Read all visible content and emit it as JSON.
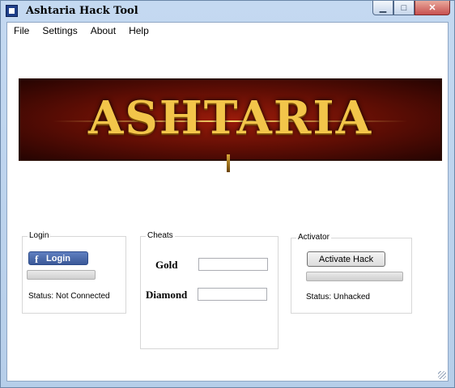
{
  "window": {
    "title": "Ashtaria Hack Tool",
    "controls": {
      "minimize": "▁",
      "maximize": "□",
      "close": "✕"
    }
  },
  "menu": [
    "File",
    "Settings",
    "About",
    "Help"
  ],
  "banner": {
    "logo_text": "ASHTARIA"
  },
  "login": {
    "legend": "Login",
    "button_label": "Login",
    "facebook_glyph": "f",
    "status": "Status: Not Connected"
  },
  "cheats": {
    "legend": "Cheats",
    "gold_label": "Gold",
    "gold_value": "",
    "diamond_label": "Diamond",
    "diamond_value": ""
  },
  "activator": {
    "legend": "Activator",
    "button_label": "Activate Hack",
    "status": "Status: Unhacked"
  },
  "colors": {
    "facebook_blue": "#3b5998",
    "banner_red": "#9a1b0a",
    "logo_gold": "#f2c54a"
  }
}
